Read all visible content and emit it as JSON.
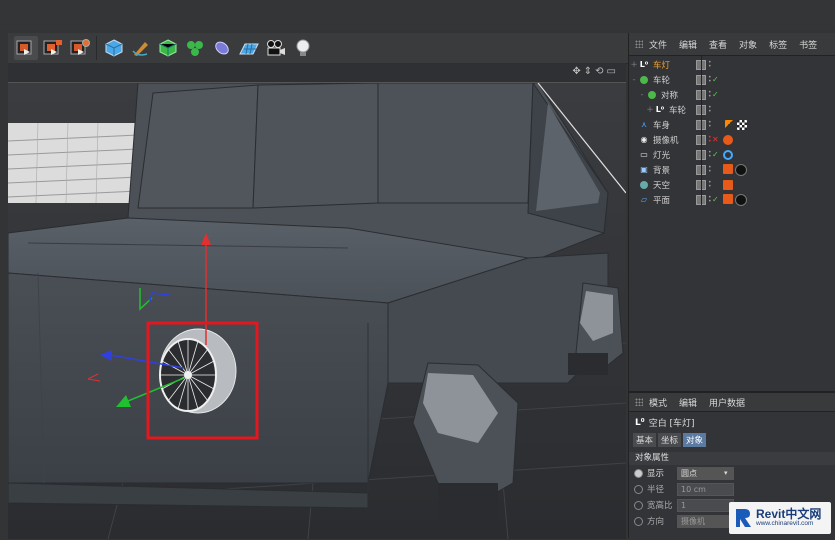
{
  "colors": {
    "selection_box": "#e5161e",
    "axis_y": "#e03030",
    "axis_x": "#3040e0",
    "axis_z": "#20c030",
    "accent_label": "#f0a030"
  },
  "toolbar": {
    "groups": [
      [
        "render-view-icon",
        "render-picture-icon",
        "render-settings-icon"
      ],
      [
        "cube-icon",
        "pen-spline-icon",
        "subdivision-icon",
        "cloner-icon",
        "deformer-icon",
        "floor-icon",
        "camera-icon",
        "light-icon"
      ]
    ]
  },
  "object_manager": {
    "menu": [
      "文件",
      "编辑",
      "查看",
      "对象",
      "标签",
      "书签"
    ],
    "objects": [
      {
        "label": "车灯",
        "selected": true,
        "icon": "null-icon",
        "indent": 0,
        "tree": "+"
      },
      {
        "label": "车轮",
        "selected": false,
        "icon": "sphere-icon",
        "indent": 0,
        "tree": "-"
      },
      {
        "label": "对称",
        "selected": false,
        "icon": "symmetry-icon",
        "indent": 1,
        "tree": "-"
      },
      {
        "label": "车轮",
        "selected": false,
        "icon": "null-icon",
        "indent": 2,
        "tree": "+"
      },
      {
        "label": "车身",
        "selected": false,
        "icon": "polygon-icon",
        "indent": 0,
        "tree": ""
      },
      {
        "label": "摄像机",
        "selected": false,
        "icon": "camera-icon",
        "indent": 0,
        "tree": ""
      },
      {
        "label": "灯光",
        "selected": false,
        "icon": "light-icon",
        "indent": 0,
        "tree": ""
      },
      {
        "label": "背景",
        "selected": false,
        "icon": "background-icon",
        "indent": 0,
        "tree": ""
      },
      {
        "label": "天空",
        "selected": false,
        "icon": "sky-icon",
        "indent": 0,
        "tree": ""
      },
      {
        "label": "平面",
        "selected": false,
        "icon": "plane-icon",
        "indent": 0,
        "tree": ""
      }
    ]
  },
  "attributes": {
    "menu": [
      "模式",
      "编辑",
      "用户数据"
    ],
    "title": "空白 [车灯]",
    "tabs": [
      "基本",
      "坐标",
      "对象"
    ],
    "active_tab": "对象",
    "section": "对象属性",
    "props": [
      {
        "label": "显示",
        "value": "圆点"
      },
      {
        "label": "半径",
        "value": "10 cm"
      },
      {
        "label": "宽高比",
        "value": "1"
      },
      {
        "label": "方向",
        "value": "摄像机"
      }
    ]
  },
  "watermark": {
    "brand": "Revit中文网",
    "url": "www.chinarevit.com"
  }
}
